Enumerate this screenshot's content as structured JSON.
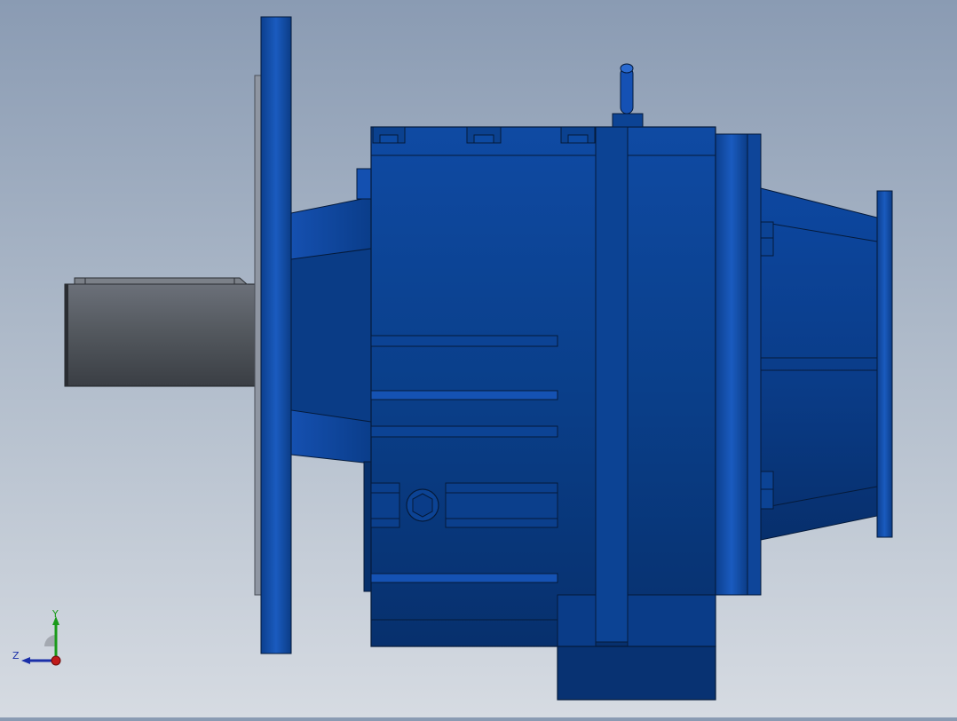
{
  "scene": {
    "subject": "gearbox-assembly",
    "colors": {
      "body": "#0a3f8a",
      "body_dark": "#062c66",
      "body_light": "#1d5fc7",
      "shaft": "#5a5f68",
      "edge": "#051a3a"
    }
  },
  "triad": {
    "x_label": "",
    "y_label": "Y",
    "z_label": "Z",
    "colors": {
      "x": "#c01a1a",
      "y": "#1a9a1a",
      "z": "#1a2fa8"
    }
  }
}
